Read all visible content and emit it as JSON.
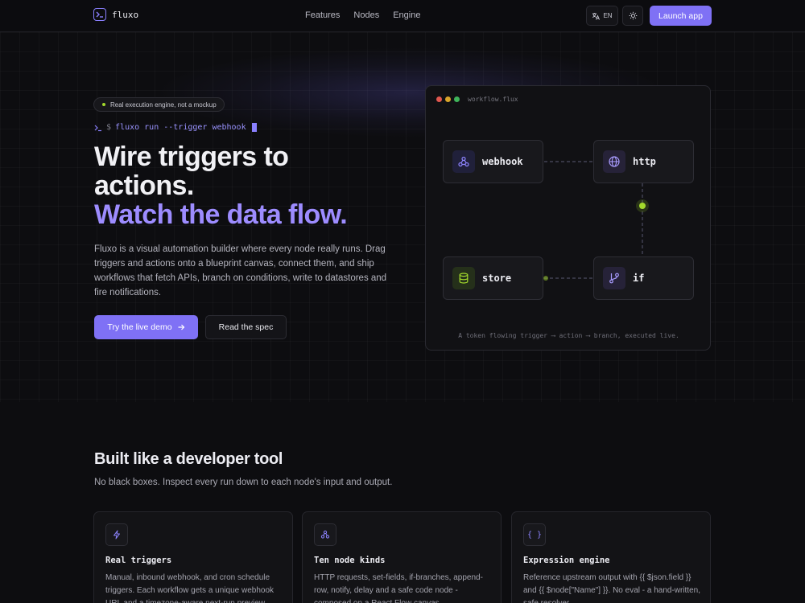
{
  "nav": {
    "brand": "fluxo",
    "links": [
      "Features",
      "Nodes",
      "Engine"
    ],
    "language": "EN",
    "launch_label": "Launch app"
  },
  "hero": {
    "badge": "Real execution engine, not a mockup",
    "cli_prompt": "$",
    "cli_command": "fluxo run --trigger webhook",
    "headline_line1": "Wire triggers to",
    "headline_line2": "actions.",
    "headline_accent": "Watch the data flow.",
    "lead": "Fluxo is a visual automation builder where every node really runs. Drag triggers and actions onto a blueprint canvas, connect them, and ship workflows that fetch APIs, branch on conditions, write to datastores and fire notifications.",
    "primary_cta": "Try the live demo",
    "secondary_cta": "Read the spec"
  },
  "workflow": {
    "filename": "workflow.flux",
    "nodes": [
      {
        "label": "webhook",
        "icon": "webhook-icon",
        "color": "#8e84ff"
      },
      {
        "label": "http",
        "icon": "globe-icon",
        "color": "#a99cff"
      },
      {
        "label": "store",
        "icon": "database-icon",
        "color": "#a3d92c"
      },
      {
        "label": "if",
        "icon": "git-branch-icon",
        "color": "#a99cff"
      }
    ],
    "caption": "A token flowing trigger ⟶ action ⟶ branch, executed live."
  },
  "features": {
    "title": "Built like a developer tool",
    "subtitle": "No black boxes. Inspect every run down to each node's input and output.",
    "cards": [
      {
        "icon": "lightning-icon",
        "title": "Real triggers",
        "body": "Manual, inbound webhook, and cron schedule triggers. Each workflow gets a unique webhook URL and a timezone-aware next-run preview."
      },
      {
        "icon": "nodes-icon",
        "title": "Ten node kinds",
        "body": "HTTP requests, set-fields, if-branches, append-row, notify, delay and a safe code node - composed on a React Flow canvas."
      },
      {
        "icon": "braces-icon",
        "title": "Expression engine",
        "body": "Reference upstream output with {{ $json.field }} and {{ $node[\"Name\"] }}. No eval - a hand-written, safe resolver."
      }
    ]
  },
  "colors": {
    "accent": "#7f71f5",
    "accent_text": "#9d8cff",
    "live_dot": "#a3d92c",
    "background": "#0d0d10"
  }
}
